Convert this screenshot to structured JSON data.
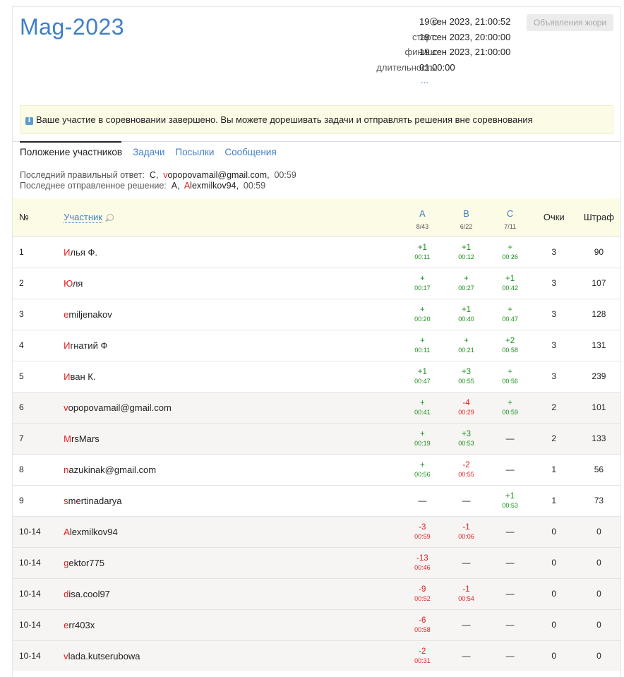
{
  "contest": {
    "title": "Mag-2023",
    "current_time": "19 сен 2023, 21:00:52",
    "start_label": "старт:",
    "start": "19 сен 2023, 20:00:00",
    "finish_label": "финиш:",
    "finish": "19 сен 2023, 21:00:00",
    "duration_label": "длительность:",
    "duration": "01:00:00",
    "more": "...",
    "jury_button": "Объявления жюри"
  },
  "notice": "Ваше участие в соревновании завершено. Вы можете дорешивать задачи и отправлять решения вне соревнования",
  "tabs": [
    "Положение участников",
    "Задачи",
    "Посылки",
    "Сообщения"
  ],
  "last": {
    "correct_label": "Последний правильный ответ:",
    "correct_problem": "C",
    "correct_user_first": "v",
    "correct_user_rest": "opopovamail@gmail.com",
    "correct_time": "00:59",
    "submitted_label": "Последнее отправленное решение:",
    "submitted_problem": "A",
    "submitted_user_first": "A",
    "submitted_user_rest": "lexmilkov94",
    "submitted_time": "00:59"
  },
  "table": {
    "headers": {
      "num": "№",
      "participant": "Участник",
      "score": "Очки",
      "penalty": "Штраф"
    },
    "problems": [
      {
        "name": "A",
        "stat": "8/43"
      },
      {
        "name": "B",
        "stat": "6/22"
      },
      {
        "name": "C",
        "stat": "7/11"
      }
    ],
    "rows": [
      {
        "place": "1",
        "first": "И",
        "rest": "лья Ф.",
        "alt": false,
        "cells": [
          [
            "+1",
            "00:11",
            "ok"
          ],
          [
            "+1",
            "00:12",
            "ok"
          ],
          [
            "+",
            "00:26",
            "ok"
          ]
        ],
        "score": "3",
        "penalty": "90"
      },
      {
        "place": "2",
        "first": "Ю",
        "rest": "ля",
        "alt": false,
        "cells": [
          [
            "+",
            "00:17",
            "ok"
          ],
          [
            "+",
            "00:27",
            "ok"
          ],
          [
            "+1",
            "00:42",
            "ok"
          ]
        ],
        "score": "3",
        "penalty": "107"
      },
      {
        "place": "3",
        "first": "e",
        "rest": "miljenakov",
        "alt": false,
        "cells": [
          [
            "+",
            "00:20",
            "ok"
          ],
          [
            "+1",
            "00:40",
            "ok"
          ],
          [
            "+",
            "00:47",
            "ok"
          ]
        ],
        "score": "3",
        "penalty": "128"
      },
      {
        "place": "4",
        "first": "И",
        "rest": "гнатий Ф",
        "alt": false,
        "cells": [
          [
            "+",
            "00:11",
            "ok"
          ],
          [
            "+",
            "00:21",
            "ok"
          ],
          [
            "+2",
            "00:58",
            "ok"
          ]
        ],
        "score": "3",
        "penalty": "131"
      },
      {
        "place": "5",
        "first": "И",
        "rest": "ван К.",
        "alt": false,
        "cells": [
          [
            "+1",
            "00:47",
            "ok"
          ],
          [
            "+3",
            "00:55",
            "ok"
          ],
          [
            "+",
            "00:56",
            "ok"
          ]
        ],
        "score": "3",
        "penalty": "239"
      },
      {
        "place": "6",
        "first": "v",
        "rest": "opopovamail@gmail.com",
        "alt": true,
        "cells": [
          [
            "+",
            "00:41",
            "ok"
          ],
          [
            "-4",
            "00:29",
            "bad"
          ],
          [
            "+",
            "00:59",
            "ok"
          ]
        ],
        "score": "2",
        "penalty": "101"
      },
      {
        "place": "7",
        "first": "M",
        "rest": "rsMars",
        "alt": true,
        "cells": [
          [
            "+",
            "00:19",
            "ok"
          ],
          [
            "+3",
            "00:53",
            "ok"
          ],
          [
            "—",
            "",
            ""
          ]
        ],
        "score": "2",
        "penalty": "133"
      },
      {
        "place": "8",
        "first": "n",
        "rest": "azukinak@gmail.com",
        "alt": false,
        "cells": [
          [
            "+",
            "00:56",
            "ok"
          ],
          [
            "-2",
            "00:55",
            "bad"
          ],
          [
            "—",
            "",
            ""
          ]
        ],
        "score": "1",
        "penalty": "56"
      },
      {
        "place": "9",
        "first": "s",
        "rest": "mertinadarya",
        "alt": false,
        "cells": [
          [
            "—",
            "",
            ""
          ],
          [
            "—",
            "",
            ""
          ],
          [
            "+1",
            "00:53",
            "ok"
          ]
        ],
        "score": "1",
        "penalty": "73"
      },
      {
        "place": "10-14",
        "first": "A",
        "rest": "lexmilkov94",
        "alt": true,
        "cells": [
          [
            "-3",
            "00:59",
            "bad"
          ],
          [
            "-1",
            "00:06",
            "bad"
          ],
          [
            "—",
            "",
            ""
          ]
        ],
        "score": "0",
        "penalty": "0"
      },
      {
        "place": "10-14",
        "first": "g",
        "rest": "ektor775",
        "alt": true,
        "cells": [
          [
            "-13",
            "00:46",
            "bad"
          ],
          [
            "—",
            "",
            ""
          ],
          [
            "—",
            "",
            ""
          ]
        ],
        "score": "0",
        "penalty": "0"
      },
      {
        "place": "10-14",
        "first": "d",
        "rest": "isa.cool97",
        "alt": true,
        "cells": [
          [
            "-9",
            "00:52",
            "bad"
          ],
          [
            "-1",
            "00:54",
            "bad"
          ],
          [
            "—",
            "",
            ""
          ]
        ],
        "score": "0",
        "penalty": "0"
      },
      {
        "place": "10-14",
        "first": "e",
        "rest": "rr403x",
        "alt": true,
        "cells": [
          [
            "-6",
            "00:58",
            "bad"
          ],
          [
            "—",
            "",
            ""
          ],
          [
            "—",
            "",
            ""
          ]
        ],
        "score": "0",
        "penalty": "0"
      },
      {
        "place": "10-14",
        "first": "v",
        "rest": "lada.kutserubowa",
        "alt": true,
        "cells": [
          [
            "-2",
            "00:31",
            "bad"
          ],
          [
            "—",
            "",
            ""
          ],
          [
            "—",
            "",
            ""
          ]
        ],
        "score": "0",
        "penalty": "0"
      }
    ]
  }
}
